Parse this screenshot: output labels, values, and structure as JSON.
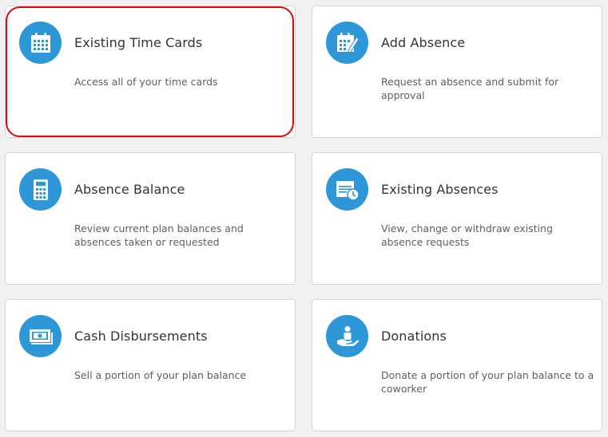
{
  "cards": [
    {
      "title": "Existing Time Cards",
      "description": "Access all of your time cards",
      "icon": "calendar-grid-icon"
    },
    {
      "title": "Add Absence",
      "description": "Request an absence and submit for approval",
      "icon": "calendar-edit-icon"
    },
    {
      "title": "Absence Balance",
      "description": "Review current plan balances and absences taken or requested",
      "icon": "calculator-icon"
    },
    {
      "title": "Existing Absences",
      "description": "View, change or withdraw existing absence requests",
      "icon": "calendar-clock-icon"
    },
    {
      "title": "Cash Disbursements",
      "description": "Sell a portion of your plan balance",
      "icon": "cash-icon"
    },
    {
      "title": "Donations",
      "description": "Donate a portion of your plan balance to a coworker",
      "icon": "donation-hand-icon"
    }
  ],
  "colors": {
    "icon_background": "#2e97d8",
    "highlight": "#e00a0a",
    "page_background": "#f1f1f1"
  }
}
